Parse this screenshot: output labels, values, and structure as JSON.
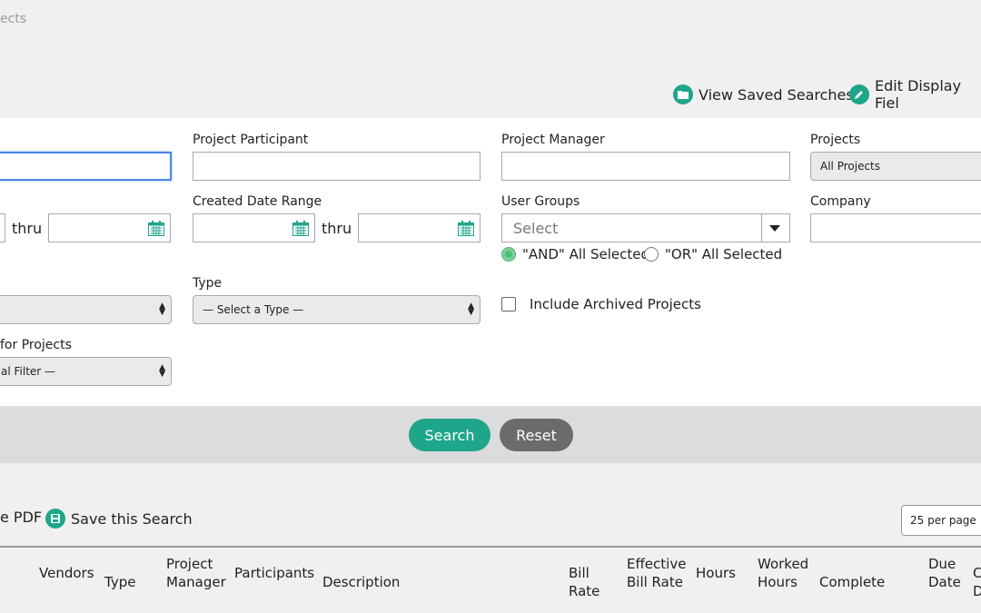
{
  "breadcrumb": "ects",
  "top_links": {
    "view_saved": "View Saved Searches",
    "edit_display": "Edit Display Fiel"
  },
  "form": {
    "project_participant_label": "Project Participant",
    "project_manager_label": "Project Manager",
    "projects_label": "Projects",
    "projects_value": "All Projects",
    "created_date_label": "Created Date Range",
    "thru": "thru",
    "user_groups_label": "User Groups",
    "user_groups_placeholder": "Select",
    "and_label": "\"AND\" All Selected",
    "or_label": "\"OR\" All Selected",
    "company_label": "Company",
    "type_label": "Type",
    "type_value": "— Select a Type —",
    "include_archived": "Include Archived Projects",
    "custom_filter_label": "for Projects",
    "custom_filter_value": "al Filter —"
  },
  "buttons": {
    "search": "Search",
    "reset": "Reset"
  },
  "results": {
    "pdf_label": "e PDF",
    "save_search": "Save this Search",
    "per_page": "25 per page"
  },
  "columns": {
    "vendors": "Vendors",
    "type": "Type",
    "pm_line1": "Project",
    "pm_line2": "Manager",
    "participants": "Participants",
    "description": "Description",
    "bill_line1": "Bill",
    "bill_line2": "Rate",
    "eff_line1": "Effective",
    "eff_line2": "Bill Rate",
    "hours": "Hours",
    "worked_line1": "Worked",
    "worked_line2": "Hours",
    "complete": "Complete",
    "due_line1": "Due",
    "due_line2": "Date",
    "cut_line1": "C",
    "cut_line2": "D"
  },
  "colors": {
    "accent": "#1fa58a",
    "reset_button": "#6b6b6b",
    "focus_border": "#4a86e8"
  }
}
